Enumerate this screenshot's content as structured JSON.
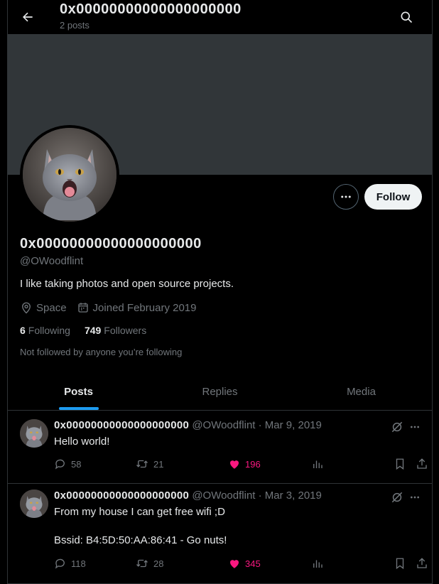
{
  "header": {
    "title": "0x00000000000000000000",
    "subtitle": "2 posts"
  },
  "profile": {
    "display_name": "0x00000000000000000000",
    "handle": "@OWoodflint",
    "bio": "I like taking photos and open source projects.",
    "location": "Space",
    "joined": "Joined February 2019",
    "following_count": "6",
    "following_label": "Following",
    "followers_count": "749",
    "followers_label": "Followers",
    "not_followed": "Not followed by anyone you’re following",
    "follow_label": "Follow"
  },
  "tabs": [
    {
      "label": "Posts",
      "active": true
    },
    {
      "label": "Replies",
      "active": false
    },
    {
      "label": "Media",
      "active": false
    }
  ],
  "posts": [
    {
      "name": "0x00000000000000000000",
      "meta": "@OWoodflint · Mar 9, 2019",
      "text": "Hello world!",
      "replies": "58",
      "reposts": "21",
      "likes": "196"
    },
    {
      "name": "0x00000000000000000000",
      "meta": "@OWoodflint · Mar 3, 2019",
      "text": "From my house I can get free wifi ;D\n\nBssid: B4:5D:50:AA:86:41 - Go nuts!",
      "replies": "118",
      "reposts": "28",
      "likes": "345"
    }
  ],
  "colors": {
    "accent": "#1d9bf0",
    "like": "#f91880",
    "banner": "#313639"
  }
}
